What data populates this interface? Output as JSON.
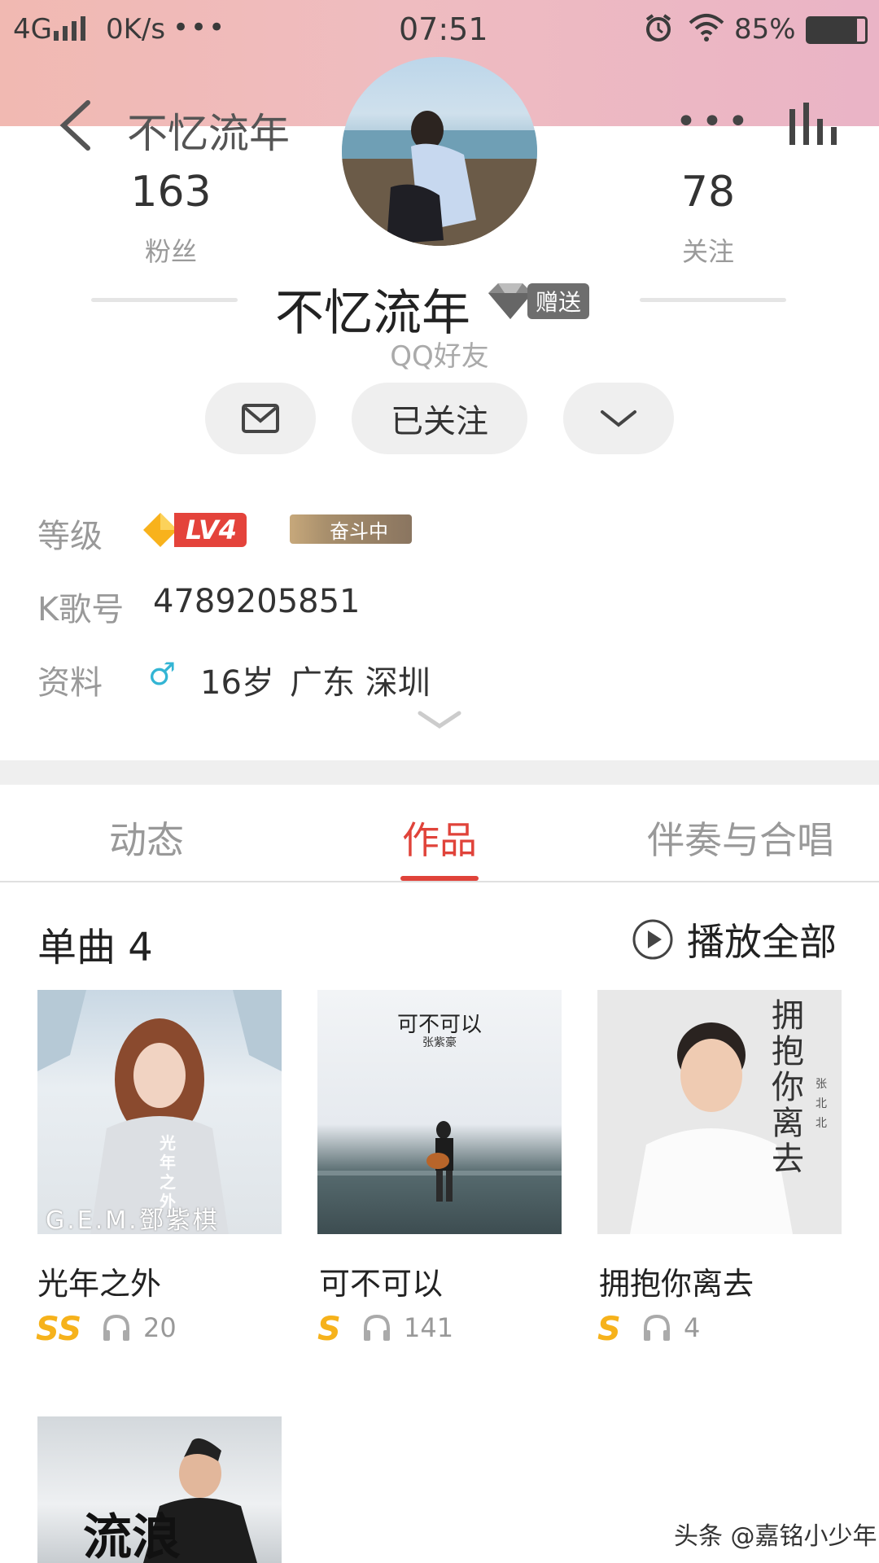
{
  "status_bar": {
    "network": "4G",
    "speed": "0K/s",
    "dots": "•••",
    "time": "07:51",
    "battery": "85%"
  },
  "nav": {
    "title": "不忆流年",
    "more": "•••"
  },
  "profile": {
    "fans_count": "163",
    "fans_label": "粉丝",
    "following_count": "78",
    "following_label": "关注",
    "name": "不忆流年",
    "gift_badge": "赠送",
    "relation": "QQ好友",
    "follow_button": "已关注"
  },
  "info": {
    "level_label": "等级",
    "level_badge": "LV4",
    "level_status": "奋斗中",
    "id_label": "K歌号",
    "id_value": "4789205851",
    "profile_label": "资料",
    "gender_icon": "♂",
    "age": "16岁",
    "location": "广东 深圳"
  },
  "tabs": [
    {
      "label": "动态",
      "active": false
    },
    {
      "label": "作品",
      "active": true
    },
    {
      "label": "伴奏与合唱",
      "active": false
    }
  ],
  "works": {
    "section_title": "单曲 4",
    "play_all": "播放全部",
    "songs": [
      {
        "title": "光年之外",
        "grade": "SS",
        "plays": "20",
        "cover_text": "G.E.M.鄧紫棋",
        "cover_side": "光年之外"
      },
      {
        "title": "可不可以",
        "grade": "S",
        "plays": "141",
        "cover_text": "可不可以",
        "cover_sub": "张紫豪"
      },
      {
        "title": "拥抱你离去",
        "grade": "S",
        "plays": "4",
        "cover_text": "拥抱你离去",
        "cover_sub": "张北北"
      },
      {
        "title": "",
        "grade": "",
        "plays": "",
        "cover_text": "流浪"
      }
    ]
  },
  "watermark": "头条 @嘉铭小少年",
  "colors": {
    "accent": "#e0433a",
    "grade": "#f6b21b",
    "header_pink": "#efbcc0"
  }
}
